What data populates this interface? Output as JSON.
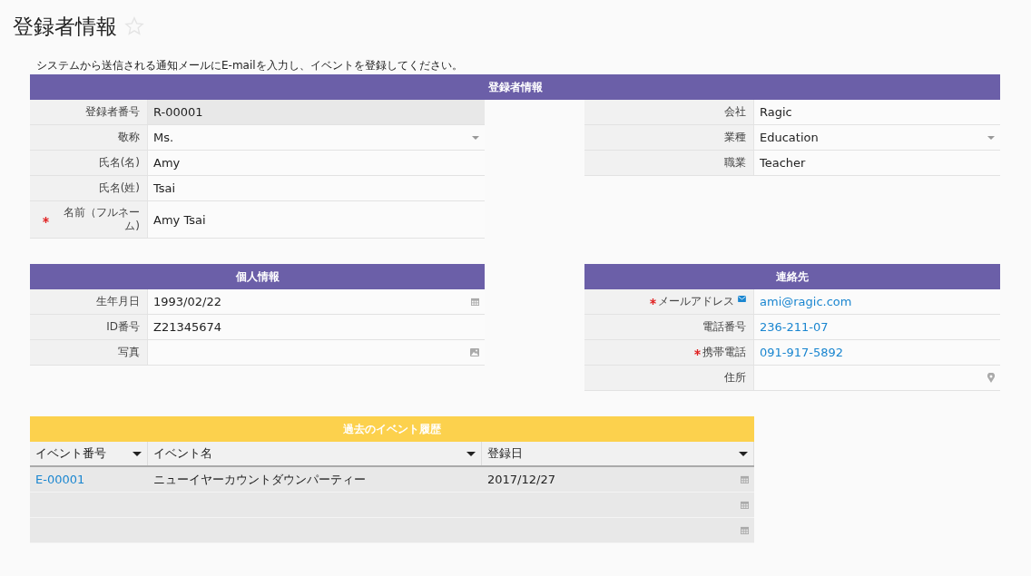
{
  "page": {
    "title": "登録者情報",
    "favorite": false
  },
  "instruction": "システムから送信される通知メールにE-mailを入力し、イベントを登録してください。",
  "registrant": {
    "title": "登録者情報",
    "color": "#6b5fa8",
    "left": [
      {
        "label": "登録者番号",
        "value": "R-00001",
        "kind": "readonly",
        "required": false
      },
      {
        "label": "敬称",
        "value": "Ms.",
        "kind": "select",
        "required": false
      },
      {
        "label": "氏名(名)",
        "value": "Amy",
        "kind": "text",
        "required": false
      },
      {
        "label": "氏名(姓)",
        "value": "Tsai",
        "kind": "text",
        "required": false
      },
      {
        "label": "名前（フルネーム)",
        "value": "Amy Tsai",
        "kind": "text",
        "required": true
      }
    ],
    "right": [
      {
        "label": "会社",
        "value": "Ragic",
        "kind": "text",
        "required": false
      },
      {
        "label": "業種",
        "value": "Education",
        "kind": "select",
        "required": false
      },
      {
        "label": "職業",
        "value": "Teacher",
        "kind": "text",
        "required": false
      }
    ]
  },
  "personal": {
    "title": "個人情報",
    "color": "#6b5fa8",
    "fields": [
      {
        "label": "生年月日",
        "value": "1993/02/22",
        "kind": "date",
        "required": false
      },
      {
        "label": "ID番号",
        "value": "Z21345674",
        "kind": "text",
        "required": false
      },
      {
        "label": "写真",
        "kind": "image",
        "required": false
      }
    ]
  },
  "contact": {
    "title": "連絡先",
    "color": "#6b5fa8",
    "fields": [
      {
        "label": "メールアドレス",
        "value": "ami@ragic.com",
        "kind": "email",
        "required": true
      },
      {
        "label": "電話番号",
        "value": "236-211-07",
        "kind": "phone",
        "required": false
      },
      {
        "label": "携帯電話",
        "value": "091-917-5892",
        "kind": "phone",
        "required": true
      },
      {
        "label": "住所",
        "kind": "location",
        "required": false
      }
    ]
  },
  "history": {
    "title": "過去のイベント履歴",
    "color": "#fcd14d",
    "columns": [
      {
        "label": "イベント番号"
      },
      {
        "label": "イベント名"
      },
      {
        "label": "登録日"
      }
    ],
    "rows": [
      {
        "kind": "entry",
        "cells": [
          "E-00001",
          "ニューイヤーカウントダウンパーティー",
          "2017/12/27"
        ]
      },
      {
        "kind": "blank"
      },
      {
        "kind": "blank"
      }
    ]
  }
}
